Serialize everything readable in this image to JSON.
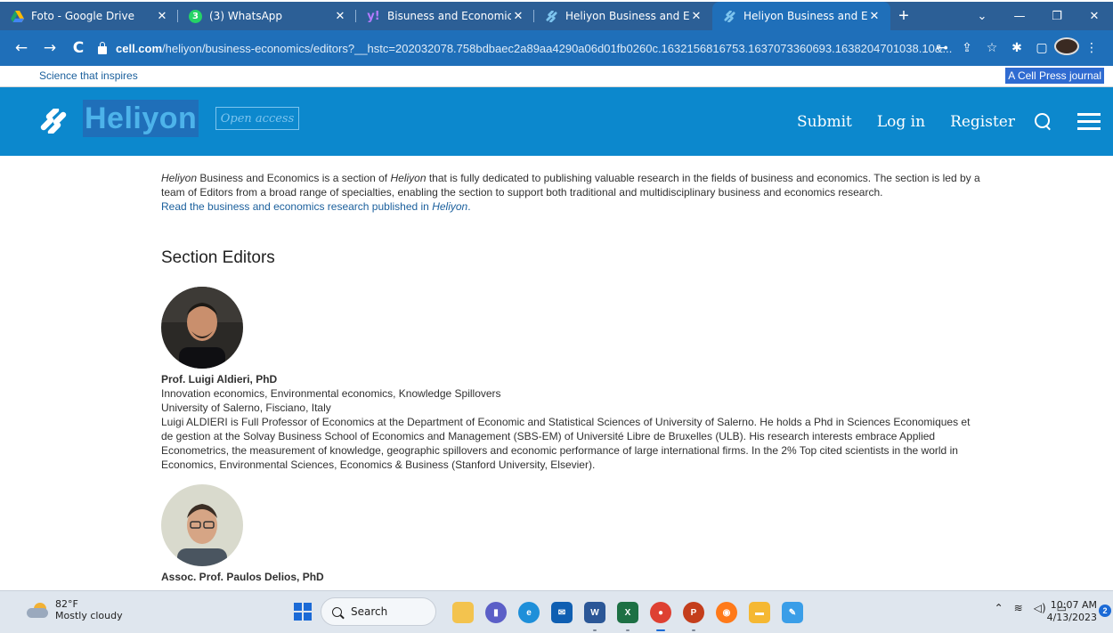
{
  "browser": {
    "tabs": [
      {
        "title": "Foto - Google Drive",
        "icon": "google-drive-icon",
        "active": false
      },
      {
        "title": "(3) WhatsApp",
        "icon": "whatsapp-icon",
        "active": false,
        "badge": "3"
      },
      {
        "title": "Bisuness and Economics Heli",
        "icon": "yahoo-icon",
        "active": false
      },
      {
        "title": "Heliyon Business and Econon",
        "icon": "heliyon-icon",
        "active": false
      },
      {
        "title": "Heliyon Business and Econon",
        "icon": "heliyon-icon",
        "active": true
      }
    ],
    "url_host": "cell.com",
    "url_rest": "/heliyon/business-economics/editors?__hstc=202032078.758bdbaec2a89aa4290a06d01fb0260c.1632156816753.1637073360693.1638204701038.10&..."
  },
  "site": {
    "tagline": "Science that inspires",
    "journal_badge": "A Cell Press journal",
    "logo_text": "Heliyon",
    "open_access": "Open access",
    "nav": {
      "submit": "Submit",
      "login": "Log in",
      "register": "Register"
    }
  },
  "content": {
    "intro_em": "Heliyon",
    "intro_rest": " Business and Economics is a section of ",
    "intro_em2": "Heliyon",
    "intro_tail": " that is fully dedicated to publishing valuable research in the fields of business and economics. The section is led by a team of Editors from a broad range of specialties, enabling the section to support both traditional and multidisciplinary business and economics research.",
    "read_link": "Read the business and economics research published in ",
    "read_link_em": "Heliyon",
    "read_link_end": ".",
    "section_title": "Section Editors",
    "editors": [
      {
        "name": "Prof. Luigi Aldieri, PhD",
        "interests": "Innovation economics, Environmental economics, Knowledge Spillovers",
        "affiliation": "University of Salerno, Fisciano, Italy",
        "bio": "Luigi ALDIERI is Full Professor of Economics at the Department of Economic and Statistical Sciences of University of Salerno. He holds a Phd in Sciences Economiques et de gestion at the Solvay Business School of Economics and Management (SBS-EM) of Université Libre de Bruxelles (ULB). His research interests embrace Applied Econometrics, the measurement of knowledge, geographic spillovers and economic performance of large international firms. In the 2% Top cited scientists in the world in Economics, Environmental Sciences, Economics & Business (Stanford University, Elsevier)."
      },
      {
        "name": "Assoc. Prof. Paulos Delios, PhD"
      }
    ]
  },
  "taskbar": {
    "temperature": "82°F",
    "weather": "Mostly cloudy",
    "search": "Search",
    "time": "10:07 AM",
    "date": "4/13/2023",
    "notifications": "2"
  },
  "colors": {
    "header": "#0c88cd",
    "tabbar": "#2c5f96",
    "addressbar": "#1f6fb9",
    "link": "#1a5f9c"
  }
}
